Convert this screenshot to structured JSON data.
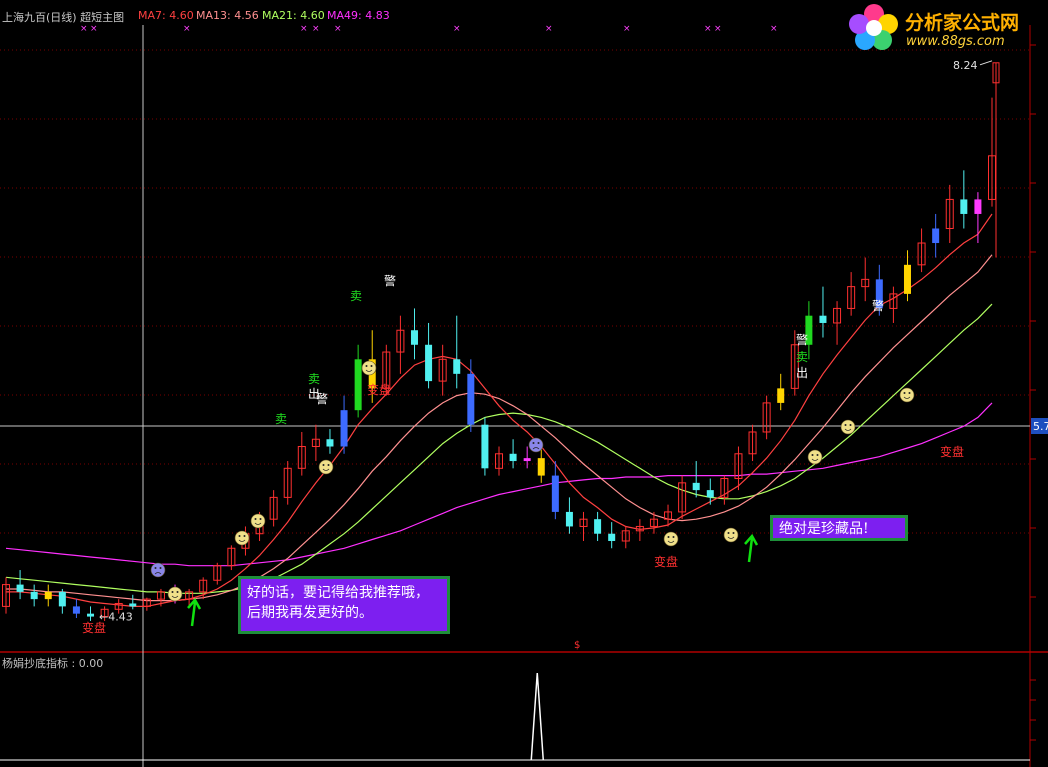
{
  "header": {
    "title": "上海九百(日线) 超短主图",
    "ma": [
      {
        "label": "MA7: 4.60",
        "color": "#ff4040"
      },
      {
        "label": "MA13: 4.56",
        "color": "#ff9090"
      },
      {
        "label": "MA21: 4.60",
        "color": "#b0ff60"
      },
      {
        "label": "MA49: 4.83",
        "color": "#ff30ff"
      }
    ]
  },
  "logo": {
    "text": "分析家公式网",
    "url": "www.88gs.com"
  },
  "price_scale": {
    "current": "5.7",
    "high_label": "8.24",
    "low_label": "4.43"
  },
  "signals": {
    "sell": "卖",
    "sell_out": "出",
    "warn": "警",
    "change": "变盘",
    "x_mark": "×"
  },
  "annotations": {
    "note1": "好的话，要记得给我推荐哦，后期我再发更好的。",
    "note2": "绝对是珍藏品!"
  },
  "indicator": {
    "label": "杨娟抄底指标 : 0.00",
    "peaks": [
      38,
      93
    ]
  },
  "colors": {
    "up": "#ff3030",
    "down": "#50f0f0",
    "ma7": "#ff4040",
    "ma13": "#ff9090",
    "ma21": "#b0ff60",
    "ma49": "#ff30ff"
  },
  "chart_data": {
    "type": "line",
    "title": "上海九百(日线) 超短主图",
    "candles": [
      [
        4.5,
        4.7,
        4.45,
        4.65
      ],
      [
        4.65,
        4.75,
        4.55,
        4.6
      ],
      [
        4.6,
        4.65,
        4.5,
        4.55
      ],
      [
        4.55,
        4.65,
        4.5,
        4.6
      ],
      [
        4.6,
        4.62,
        4.45,
        4.5
      ],
      [
        4.5,
        4.55,
        4.42,
        4.45
      ],
      [
        4.45,
        4.5,
        4.4,
        4.43
      ],
      [
        4.43,
        4.5,
        4.4,
        4.48
      ],
      [
        4.48,
        4.55,
        4.45,
        4.52
      ],
      [
        4.52,
        4.58,
        4.48,
        4.5
      ],
      [
        4.5,
        4.56,
        4.47,
        4.55
      ],
      [
        4.55,
        4.62,
        4.5,
        4.6
      ],
      [
        4.6,
        4.65,
        4.52,
        4.55
      ],
      [
        4.55,
        4.62,
        4.5,
        4.6
      ],
      [
        4.6,
        4.7,
        4.55,
        4.68
      ],
      [
        4.68,
        4.8,
        4.65,
        4.78
      ],
      [
        4.78,
        4.92,
        4.75,
        4.9
      ],
      [
        4.9,
        5.05,
        4.85,
        5.0
      ],
      [
        5.0,
        5.15,
        4.95,
        5.1
      ],
      [
        5.1,
        5.3,
        5.05,
        5.25
      ],
      [
        5.25,
        5.5,
        5.2,
        5.45
      ],
      [
        5.45,
        5.7,
        5.4,
        5.6
      ],
      [
        5.6,
        5.75,
        5.5,
        5.65
      ],
      [
        5.65,
        5.72,
        5.55,
        5.6
      ],
      [
        5.6,
        5.95,
        5.55,
        5.85
      ],
      [
        5.85,
        6.3,
        5.8,
        6.2
      ],
      [
        6.2,
        6.4,
        5.9,
        6.0
      ],
      [
        6.0,
        6.3,
        5.95,
        6.25
      ],
      [
        6.25,
        6.5,
        6.1,
        6.4
      ],
      [
        6.4,
        6.55,
        6.2,
        6.3
      ],
      [
        6.3,
        6.45,
        6.0,
        6.05
      ],
      [
        6.05,
        6.3,
        5.95,
        6.2
      ],
      [
        6.2,
        6.5,
        6.0,
        6.1
      ],
      [
        6.1,
        6.2,
        5.7,
        5.75
      ],
      [
        5.75,
        5.8,
        5.4,
        5.45
      ],
      [
        5.45,
        5.6,
        5.4,
        5.55
      ],
      [
        5.55,
        5.65,
        5.45,
        5.5
      ],
      [
        5.5,
        5.6,
        5.45,
        5.52
      ],
      [
        5.52,
        5.6,
        5.35,
        5.4
      ],
      [
        5.4,
        5.5,
        5.1,
        5.15
      ],
      [
        5.15,
        5.25,
        5.0,
        5.05
      ],
      [
        5.05,
        5.15,
        4.95,
        5.1
      ],
      [
        5.1,
        5.15,
        4.95,
        5.0
      ],
      [
        5.0,
        5.08,
        4.9,
        4.95
      ],
      [
        4.95,
        5.05,
        4.9,
        5.02
      ],
      [
        5.02,
        5.1,
        4.95,
        5.05
      ],
      [
        5.05,
        5.15,
        5.0,
        5.1
      ],
      [
        5.1,
        5.2,
        5.05,
        5.15
      ],
      [
        5.15,
        5.4,
        5.1,
        5.35
      ],
      [
        5.35,
        5.5,
        5.25,
        5.3
      ],
      [
        5.3,
        5.38,
        5.2,
        5.25
      ],
      [
        5.25,
        5.4,
        5.2,
        5.38
      ],
      [
        5.38,
        5.6,
        5.3,
        5.55
      ],
      [
        5.55,
        5.75,
        5.5,
        5.7
      ],
      [
        5.7,
        5.95,
        5.65,
        5.9
      ],
      [
        5.9,
        6.1,
        5.85,
        6.0
      ],
      [
        6.0,
        6.4,
        5.95,
        6.3
      ],
      [
        6.3,
        6.6,
        6.2,
        6.5
      ],
      [
        6.5,
        6.7,
        6.35,
        6.45
      ],
      [
        6.45,
        6.6,
        6.3,
        6.55
      ],
      [
        6.55,
        6.8,
        6.5,
        6.7
      ],
      [
        6.7,
        6.9,
        6.6,
        6.75
      ],
      [
        6.75,
        6.85,
        6.5,
        6.55
      ],
      [
        6.55,
        6.7,
        6.45,
        6.65
      ],
      [
        6.65,
        6.95,
        6.6,
        6.85
      ],
      [
        6.85,
        7.1,
        6.8,
        7.0
      ],
      [
        7.0,
        7.2,
        6.9,
        7.1
      ],
      [
        7.1,
        7.4,
        7.0,
        7.3
      ],
      [
        7.3,
        7.5,
        7.1,
        7.2
      ],
      [
        7.2,
        7.35,
        7.0,
        7.3
      ],
      [
        7.3,
        8.0,
        7.25,
        7.6
      ]
    ],
    "ma7": [
      4.6,
      4.6,
      4.59,
      4.58,
      4.57,
      4.55,
      4.53,
      4.52,
      4.51,
      4.5,
      4.5,
      4.52,
      4.54,
      4.55,
      4.58,
      4.62,
      4.68,
      4.76,
      4.85,
      4.96,
      5.08,
      5.22,
      5.35,
      5.47,
      5.6,
      5.75,
      5.86,
      5.96,
      6.07,
      6.16,
      6.2,
      6.22,
      6.2,
      6.12,
      6.0,
      5.88,
      5.78,
      5.7,
      5.6,
      5.48,
      5.35,
      5.25,
      5.18,
      5.1,
      5.05,
      5.03,
      5.04,
      5.06,
      5.12,
      5.17,
      5.22,
      5.27,
      5.33,
      5.42,
      5.52,
      5.64,
      5.78,
      5.95,
      6.1,
      6.23,
      6.35,
      6.47,
      6.57,
      6.62,
      6.68,
      6.75,
      6.83,
      6.92,
      7.0,
      7.06,
      7.2
    ],
    "ma13": [
      4.62,
      4.62,
      4.61,
      4.6,
      4.6,
      4.59,
      4.58,
      4.57,
      4.56,
      4.55,
      4.54,
      4.54,
      4.54,
      4.55,
      4.56,
      4.58,
      4.61,
      4.65,
      4.7,
      4.76,
      4.83,
      4.92,
      5.01,
      5.1,
      5.2,
      5.31,
      5.43,
      5.53,
      5.64,
      5.74,
      5.83,
      5.9,
      5.95,
      5.97,
      5.96,
      5.93,
      5.88,
      5.82,
      5.74,
      5.66,
      5.57,
      5.48,
      5.4,
      5.32,
      5.24,
      5.18,
      5.13,
      5.1,
      5.09,
      5.1,
      5.12,
      5.15,
      5.19,
      5.25,
      5.32,
      5.41,
      5.51,
      5.62,
      5.73,
      5.85,
      5.97,
      6.08,
      6.18,
      6.28,
      6.37,
      6.46,
      6.55,
      6.64,
      6.72,
      6.8,
      6.92
    ],
    "ma21": [
      4.7,
      4.69,
      4.68,
      4.67,
      4.66,
      4.65,
      4.64,
      4.63,
      4.62,
      4.61,
      4.6,
      4.6,
      4.59,
      4.59,
      4.59,
      4.6,
      4.61,
      4.63,
      4.66,
      4.69,
      4.74,
      4.79,
      4.86,
      4.93,
      5.0,
      5.08,
      5.17,
      5.26,
      5.35,
      5.44,
      5.53,
      5.62,
      5.69,
      5.75,
      5.8,
      5.82,
      5.83,
      5.82,
      5.8,
      5.77,
      5.73,
      5.68,
      5.63,
      5.57,
      5.51,
      5.45,
      5.39,
      5.34,
      5.3,
      5.27,
      5.25,
      5.24,
      5.24,
      5.26,
      5.29,
      5.33,
      5.38,
      5.45,
      5.52,
      5.6,
      5.68,
      5.77,
      5.86,
      5.95,
      6.04,
      6.13,
      6.22,
      6.31,
      6.4,
      6.48,
      6.58
    ],
    "ma49": [
      4.9,
      4.89,
      4.88,
      4.87,
      4.86,
      4.85,
      4.84,
      4.83,
      4.82,
      4.81,
      4.8,
      4.79,
      4.79,
      4.78,
      4.78,
      4.78,
      4.78,
      4.79,
      4.8,
      4.81,
      4.82,
      4.84,
      4.86,
      4.88,
      4.9,
      4.93,
      4.96,
      4.99,
      5.02,
      5.06,
      5.1,
      5.14,
      5.18,
      5.21,
      5.24,
      5.27,
      5.29,
      5.31,
      5.33,
      5.35,
      5.36,
      5.37,
      5.38,
      5.38,
      5.39,
      5.39,
      5.39,
      5.4,
      5.4,
      5.4,
      5.4,
      5.4,
      5.4,
      5.41,
      5.41,
      5.42,
      5.43,
      5.44,
      5.45,
      5.47,
      5.49,
      5.51,
      5.53,
      5.56,
      5.59,
      5.62,
      5.66,
      5.7,
      5.74,
      5.8,
      5.9
    ],
    "ylim": [
      4.2,
      8.5
    ]
  }
}
